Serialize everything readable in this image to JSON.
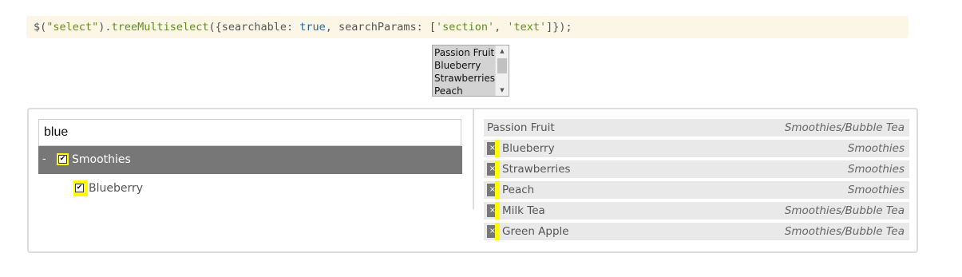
{
  "code": {
    "prefix": "$(",
    "selector": "\"select\"",
    "mid1": ").",
    "method": "treeMultiselect",
    "mid2": "({searchable: ",
    "bool": "true",
    "mid3": ", searchParams: [",
    "p1": "'section'",
    "sep": ", ",
    "p2": "'text'",
    "suffix": "]});"
  },
  "native_select": {
    "options": [
      "Passion Fruit",
      "Blueberry",
      "Strawberries",
      "Peach"
    ]
  },
  "tree": {
    "search_value": "blue",
    "section": {
      "toggle": "-",
      "label": "Smoothies",
      "checked": true
    },
    "items": [
      {
        "label": "Blueberry",
        "checked": true
      }
    ]
  },
  "selected": [
    {
      "label": "Passion Fruit",
      "section": "Smoothies/Bubble Tea",
      "removable": false
    },
    {
      "label": "Blueberry",
      "section": "Smoothies",
      "removable": true
    },
    {
      "label": "Strawberries",
      "section": "Smoothies",
      "removable": true
    },
    {
      "label": "Peach",
      "section": "Smoothies",
      "removable": true
    },
    {
      "label": "Milk Tea",
      "section": "Smoothies/Bubble Tea",
      "removable": true
    },
    {
      "label": "Green Apple",
      "section": "Smoothies/Bubble Tea",
      "removable": true
    }
  ],
  "icons": {
    "remove": "close-icon",
    "check": "checkmark-icon"
  },
  "colors": {
    "highlight": "#fffb00",
    "section_bg": "#777777",
    "code_bg": "#fcf6e6",
    "item_bg": "#e9e9e9"
  }
}
